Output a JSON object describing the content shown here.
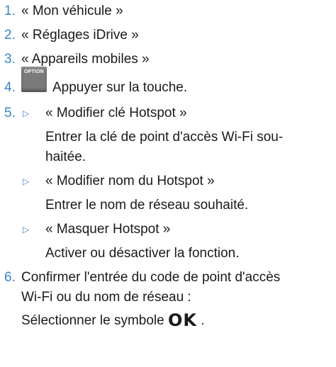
{
  "steps": [
    {
      "number": "1.",
      "text": "« Mon véhicule »"
    },
    {
      "number": "2.",
      "text": "« Réglages iDrive »"
    },
    {
      "number": "3.",
      "text": "« Appareils mobiles »"
    },
    {
      "number": "4.",
      "button_label": "OPTION",
      "text": "Appuyer sur la touche."
    },
    {
      "number": "5.",
      "options": [
        {
          "label": "« Modifier clé Hotspot »",
          "desc_line1": "Entrer la clé de point d'accès Wi-Fi sou-",
          "desc_line2": "haitée."
        },
        {
          "label": "« Modifier nom du Hotspot »",
          "desc_line1": "Entrer le nom de réseau souhaité."
        },
        {
          "label": "« Masquer Hotspot »",
          "desc_line1": "Activer ou désactiver la fonction."
        }
      ]
    },
    {
      "number": "6.",
      "line1": "Confirmer l'entrée du code de point d'accès",
      "line2": "Wi-Fi ou du nom de réseau :",
      "line3_prefix": "Sélectionner le symbole",
      "line3_symbol": "OK",
      "line3_suffix": "."
    }
  ],
  "colors": {
    "accent": "#3a86c8",
    "text": "#1a1a1a",
    "option_key": "#7a7a7a"
  },
  "bullet_icon": "triangle-right-icon"
}
